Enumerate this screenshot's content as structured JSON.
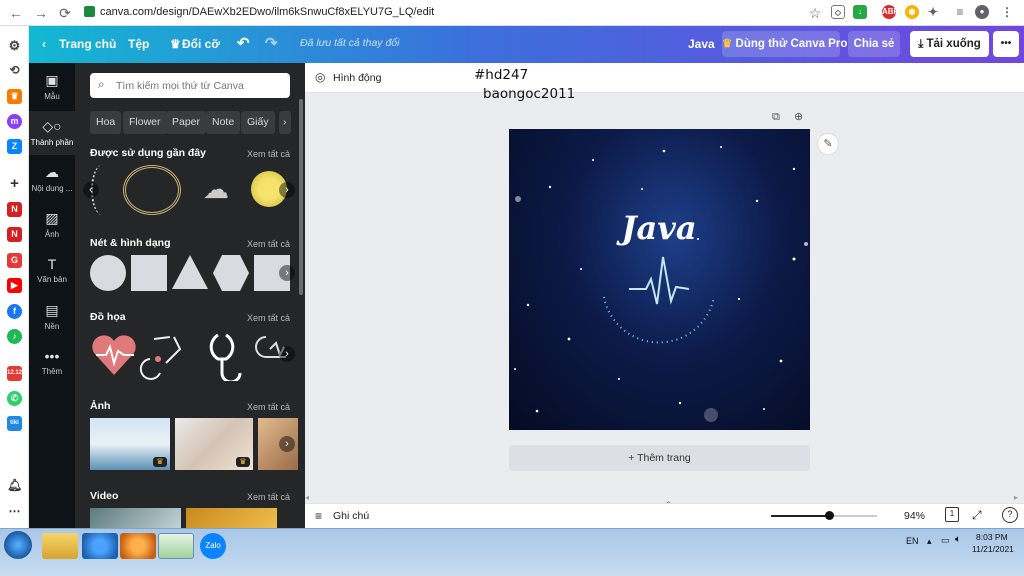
{
  "browser": {
    "url": "canva.com/design/DAEwXb2EDwo/ilm6kSnwuCf8xELYU7G_LQ/edit"
  },
  "header": {
    "home": "Trang chủ",
    "file": "Tệp",
    "resize": "Đổi cỡ",
    "saved_status": "Đã lưu tất cả thay đổi",
    "project_title": "Java",
    "try_pro": "Dùng thử Canva Pro",
    "share": "Chia sẻ",
    "download": "Tải xuống",
    "more": "•••"
  },
  "tools": [
    {
      "label": "Mẫu",
      "icon": "template-icon"
    },
    {
      "label": "Thành phần",
      "icon": "elements-icon"
    },
    {
      "label": "Nội dung ...",
      "icon": "upload-icon"
    },
    {
      "label": "Ảnh",
      "icon": "photo-icon"
    },
    {
      "label": "Văn bản",
      "icon": "text-icon"
    },
    {
      "label": "Nền",
      "icon": "background-icon"
    },
    {
      "label": "Thêm",
      "icon": "more-icon"
    }
  ],
  "panel": {
    "search_placeholder": "Tìm kiếm mọi thứ từ Canva",
    "chips": [
      "Hoa",
      "Flower",
      "Paper",
      "Note",
      "Giấy"
    ],
    "see_all": "Xem tất cả",
    "sections": {
      "recent": "Được sử dụng gần đây",
      "shapes": "Nét & hình dạng",
      "graphics": "Đồ họa",
      "photos": "Ảnh",
      "video": "Video"
    }
  },
  "canvas": {
    "animate": "Hình động",
    "design_text": "Java",
    "add_page": "+ Thêm trang"
  },
  "overlay": {
    "line1": "#hd247",
    "line2": "baongoc2011"
  },
  "bottom": {
    "notes": "Ghi chú",
    "zoom": "94%",
    "zoom_level": 0.55
  },
  "taskbar": {
    "lang": "EN",
    "time": "8:03 PM",
    "date": "11/21/2021"
  },
  "colors": {
    "header_start": "#13b8d2",
    "header_end": "#7246e0",
    "panel_bg": "#252627",
    "tool_bg": "#0e1318"
  }
}
